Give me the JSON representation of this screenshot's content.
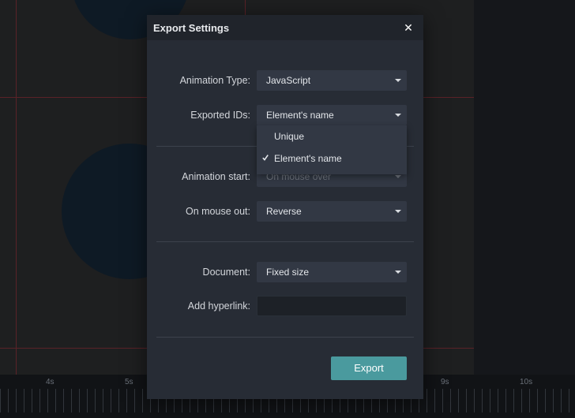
{
  "dialog": {
    "title": "Export Settings",
    "close_icon": "close-icon"
  },
  "fields": {
    "animation_type": {
      "label": "Animation Type:",
      "value": "JavaScript"
    },
    "exported_ids": {
      "label": "Exported IDs:",
      "value": "Element's name",
      "options": [
        {
          "label": "Unique",
          "checked": false
        },
        {
          "label": "Element's name",
          "checked": true
        }
      ]
    },
    "animation_start": {
      "label": "Animation start:",
      "value": "On mouse over"
    },
    "on_mouse_out": {
      "label": "On mouse out:",
      "value": "Reverse"
    },
    "document": {
      "label": "Document:",
      "value": "Fixed size"
    },
    "add_hyperlink": {
      "label": "Add hyperlink:",
      "value": "",
      "placeholder": ""
    }
  },
  "actions": {
    "export_label": "Export"
  },
  "timeline": {
    "labels": [
      "4s",
      "5s",
      "9s",
      "10s"
    ]
  },
  "colors": {
    "accent": "#4a9a9e",
    "dialog_bg": "#272c35",
    "select_bg": "#323844"
  }
}
